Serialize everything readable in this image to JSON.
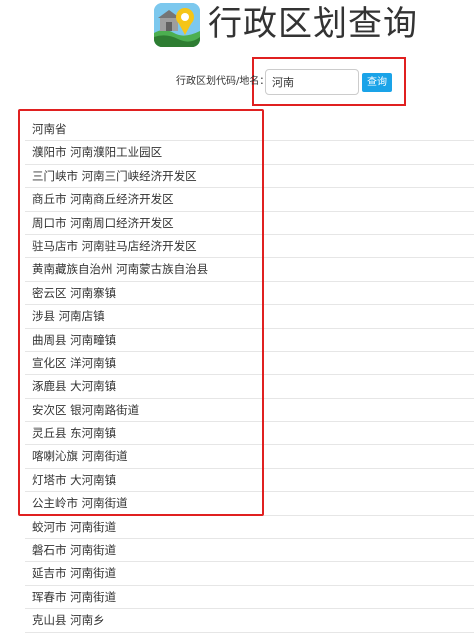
{
  "header": {
    "icon": "map-pin-icon",
    "title": "行政区划查询"
  },
  "search": {
    "label": "行政区划代码/地名：",
    "value": "河南",
    "button_label": "查询"
  },
  "results": [
    "河南省",
    "濮阳市 河南濮阳工业园区",
    "三门峡市 河南三门峡经济开发区",
    "商丘市 河南商丘经济开发区",
    "周口市 河南周口经济开发区",
    "驻马店市 河南驻马店经济开发区",
    "黄南藏族自治州 河南蒙古族自治县",
    "密云区 河南寨镇",
    "涉县 河南店镇",
    "曲周县 河南疃镇",
    "宣化区 洋河南镇",
    "涿鹿县 大河南镇",
    "安次区 银河南路街道",
    "灵丘县 东河南镇",
    "喀喇沁旗 河南街道",
    "灯塔市 大河南镇",
    "公主岭市 河南街道",
    "蛟河市 河南街道",
    "磐石市 河南街道",
    "延吉市 河南街道",
    "珲春市 河南街道",
    "克山县 河南乡"
  ],
  "colors": {
    "highlight": "#e02020",
    "button": "#1aa3e8",
    "divider": "#e6e6e6"
  }
}
